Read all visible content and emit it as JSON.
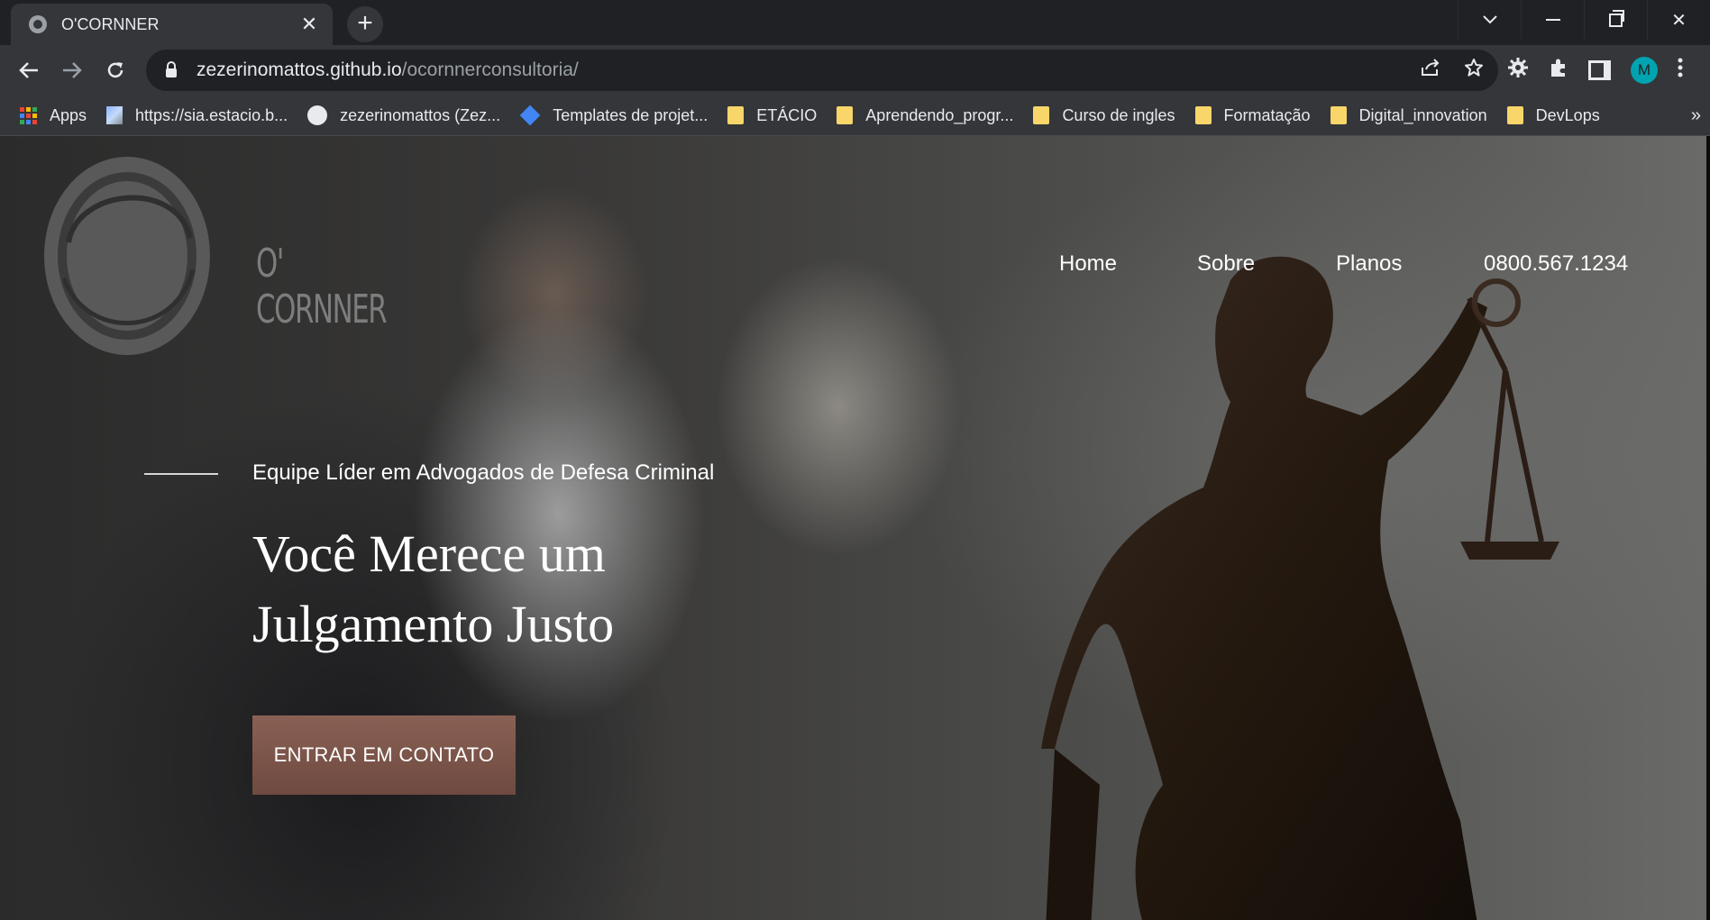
{
  "browser": {
    "tab": {
      "title": "O'CORNNER"
    },
    "url": {
      "host": "zezerinomattos.github.io",
      "path": "/ocornnerconsultoria/"
    },
    "profile_initial": "M",
    "bookmarks": [
      {
        "label": "Apps",
        "icon": "apps-grid-icon"
      },
      {
        "label": "https://sia.estacio.b...",
        "icon": "image-icon"
      },
      {
        "label": "zezerinomattos (Zez...",
        "icon": "github-icon"
      },
      {
        "label": "Templates de projet...",
        "icon": "diamond-icon"
      },
      {
        "label": "ETÁCIO",
        "icon": "folder-icon"
      },
      {
        "label": "Aprendendo_progr...",
        "icon": "folder-icon"
      },
      {
        "label": "Curso de ingles",
        "icon": "folder-icon"
      },
      {
        "label": "Formatação",
        "icon": "folder-icon"
      },
      {
        "label": "Digital_innovation",
        "icon": "folder-icon"
      },
      {
        "label": "DevLops",
        "icon": "folder-icon"
      }
    ],
    "bookmarks_more": "»"
  },
  "site": {
    "logo_text": "O' CORNNER",
    "nav": [
      {
        "label": "Home"
      },
      {
        "label": "Sobre"
      },
      {
        "label": "Planos"
      },
      {
        "label": "0800.567.1234"
      }
    ],
    "hero": {
      "eyebrow": "Equipe Líder em Advogados de Defesa Criminal",
      "title_line1": "Você Merece um",
      "title_line2": "Julgamento Justo",
      "cta_label": "ENTRAR EM CONTATO"
    },
    "colors": {
      "cta": "#7d574c",
      "accent_text": "#ffffff"
    }
  }
}
